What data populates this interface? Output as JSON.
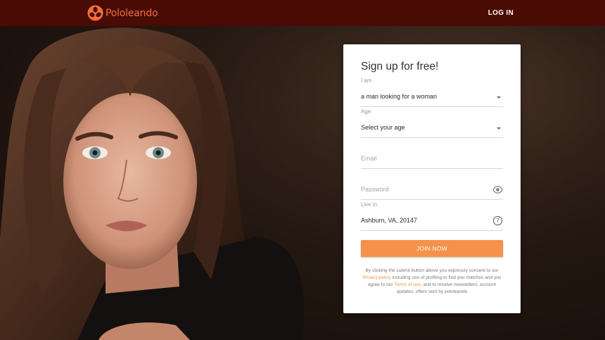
{
  "brand": {
    "name": "Pololeando",
    "accent": "#f26f3d",
    "header_bg": "#4a0b04",
    "button_color": "#f5914a"
  },
  "header": {
    "login_label": "LOG IN"
  },
  "form": {
    "title": "Sign up for free!",
    "i_am": {
      "label": "I am",
      "value": "a man looking for a woman"
    },
    "age": {
      "label": "Age",
      "value": "Select your age"
    },
    "email": {
      "placeholder": "Email"
    },
    "password": {
      "placeholder": "Password",
      "icon": "eye-icon"
    },
    "live_in": {
      "label": "Live in",
      "value": "Ashburn, VA, 20147",
      "icon": "help-icon"
    },
    "join_label": "JOIN NOW",
    "consent": {
      "part1": "By clicking the submit button above you expressly consent to our ",
      "privacy_link": "Privacy policy",
      "part2": " including use of profiling to find you matches and you agree to our ",
      "terms_link": "Terms of use",
      "part3": ", and to receive newsletters, account updates, offers sent by pololeando"
    }
  }
}
